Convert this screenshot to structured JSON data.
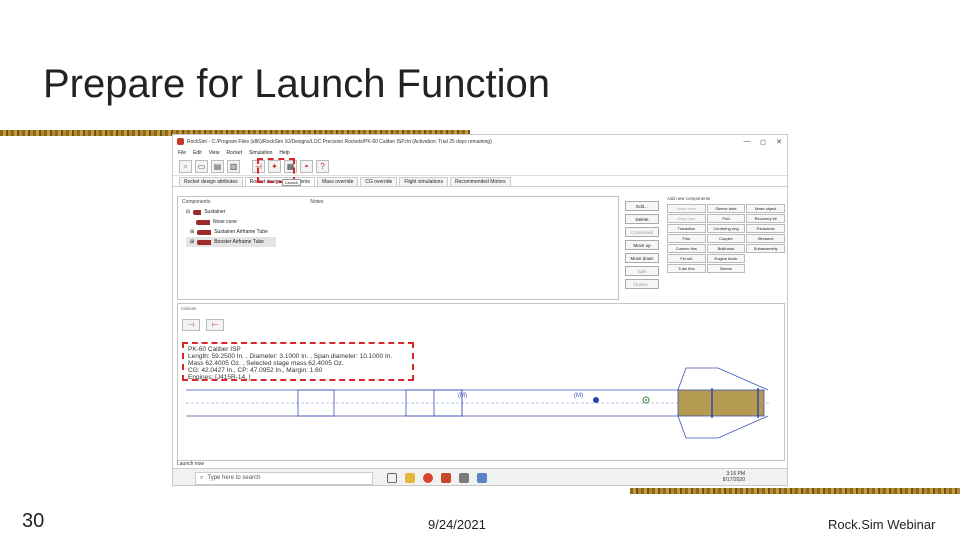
{
  "slide": {
    "title": "Prepare for Launch Function",
    "number": "30",
    "date": "9/24/2021",
    "brand": "Rock.Sim Webinar",
    "accent_color": "#b08a32",
    "highlight_color": "#d8262b"
  },
  "window": {
    "title": "RockSim - C:/Program Files (x86)/RockSim 10/Designs/LOC Precision Rockets/PK-60 Caliber ISP.rkt (Activation: Trial 25 days remaining)",
    "controls": {
      "minimize": "—",
      "maximize": "◻",
      "close": "✕"
    }
  },
  "menubar": [
    "File",
    "Edit",
    "View",
    "Rocket",
    "Simulation",
    "Help"
  ],
  "toolbar": {
    "tooltip": "Launch"
  },
  "tabs": [
    "Rocket design attributes",
    "Rocket design components",
    "Mass override",
    "CG override",
    "Flight simulations",
    "Recommended Motors"
  ],
  "designer": {
    "col_components": "Components",
    "col_notes": "Notes",
    "tree": [
      {
        "label": "Sustainer",
        "selected": false
      },
      {
        "label": "Nose cone",
        "selected": false
      },
      {
        "label": "Sustainer Airframe Tube",
        "selected": false
      },
      {
        "label": "Booster Airframe Tube",
        "selected": true
      }
    ]
  },
  "actions": [
    "Edit...",
    "Delete",
    "Cross-feed",
    "Move up",
    "Move down",
    "Split",
    "Cluster..."
  ],
  "new_components": {
    "header": "Add new components",
    "items": [
      "Nose cone",
      "Sleeve tube",
      "Mass object",
      "Body tube",
      "Pod",
      "Recovery kit",
      "Transition",
      "Centering ring",
      "Parachute",
      "Fins",
      "Coupler",
      "Streamer",
      "Custom fins",
      "Bulkhead",
      "Subassembly",
      "Fin set",
      "Engine block",
      "",
      "Tube fins",
      "Sleeve",
      ""
    ]
  },
  "lower": {
    "label": "rocksim",
    "info": [
      "PK-60 Caliber ISP",
      "Length: 59.2500 In. , Diameter: 3.1000 In. , Span diameter: 10.1000 In.",
      "Mass 62.4005 Oz. , Selected stage mass 62.4005 Oz.",
      "CG: 42.0427 In., CP: 47.0952 In., Margin: 1.60",
      "Engines: [J415R-14, ]"
    ],
    "marker_a": "(M)",
    "marker_b": "(M)"
  },
  "status_text": "Launch now",
  "taskbar": {
    "search_placeholder": "Type here to search",
    "time": "3:16 PM",
    "date": "8/17/2020"
  }
}
